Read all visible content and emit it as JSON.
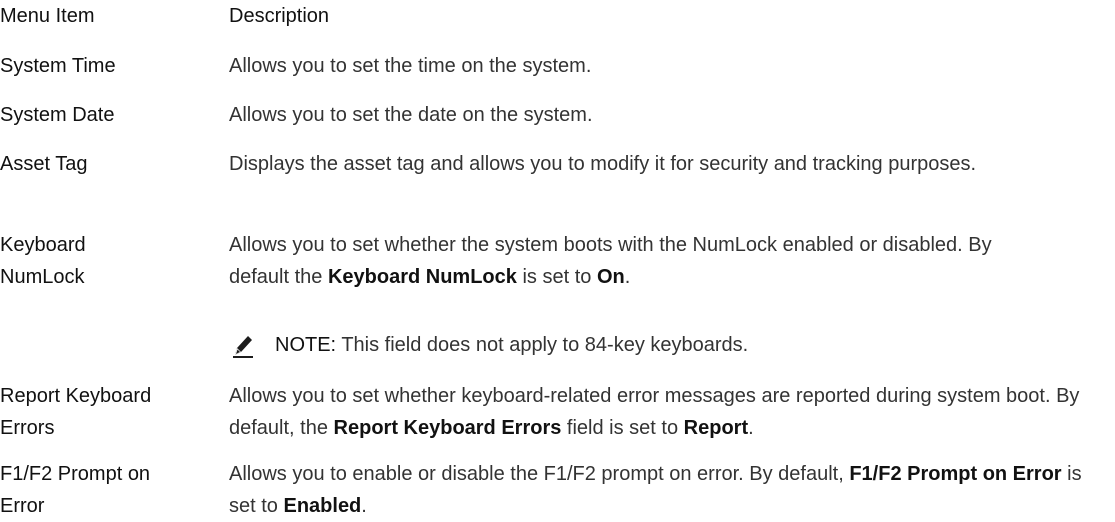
{
  "header": {
    "col1": "Menu Item",
    "col2": "Description"
  },
  "rows": [
    {
      "item": "System Time",
      "desc": "Allows you to set the time on the system."
    },
    {
      "item": "System Date",
      "desc": "Allows you to set the date on the system."
    },
    {
      "item": "Asset Tag",
      "desc": "Displays the asset tag and allows you to modify it for security and tracking purposes."
    },
    {
      "item_line1": "Keyboard",
      "item_line2": "NumLock",
      "desc_pre": "Allows you to set whether the system boots with the NumLock enabled or disabled. By default the ",
      "desc_bold1": "Keyboard NumLock",
      "desc_mid": " is set to ",
      "desc_bold2": "On",
      "desc_end": ".",
      "note_label": "NOTE:",
      "note_text": " This field does not apply to 84-key keyboards.",
      "note_icon": "pencil-note-icon"
    },
    {
      "item_line1": "Report Keyboard",
      "item_line2": "Errors",
      "desc_pre": "Allows you to set whether keyboard-related error messages are reported during system boot. By default, the ",
      "desc_bold1": "Report Keyboard Errors",
      "desc_mid": " field is set to ",
      "desc_bold2": "Report",
      "desc_end": "."
    },
    {
      "item_line1": "F1/F2 Prompt on",
      "item_line2": "Error",
      "desc_pre": "Allows you to enable or disable the F1/F2 prompt on error. By default, ",
      "desc_bold1": "F1/F2 Prompt on Error",
      "desc_mid": " is set to ",
      "desc_bold2": "Enabled",
      "desc_end": "."
    }
  ]
}
